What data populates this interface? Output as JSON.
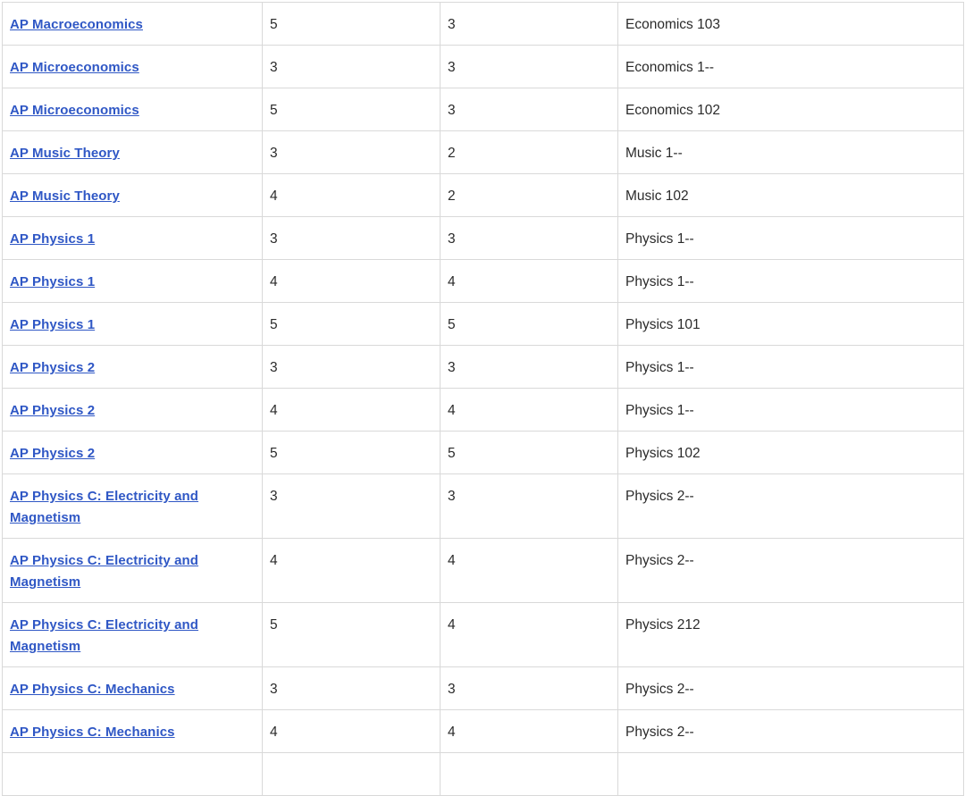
{
  "rows": [
    {
      "exam": "AP Macroeconomics",
      "score": "5",
      "credits": "3",
      "course": "Economics 103"
    },
    {
      "exam": "AP Microeconomics",
      "score": "3",
      "credits": "3",
      "course": "Economics 1--"
    },
    {
      "exam": "AP Microeconomics",
      "score": "5",
      "credits": "3",
      "course": "Economics 102"
    },
    {
      "exam": "AP Music Theory",
      "score": "3",
      "credits": "2",
      "course": "Music 1--"
    },
    {
      "exam": "AP Music Theory",
      "score": "4",
      "credits": "2",
      "course": "Music 102"
    },
    {
      "exam": "AP Physics 1",
      "score": "3",
      "credits": "3",
      "course": "Physics 1--"
    },
    {
      "exam": "AP Physics 1",
      "score": "4",
      "credits": "4",
      "course": "Physics 1--"
    },
    {
      "exam": "AP Physics 1",
      "score": "5",
      "credits": "5",
      "course": "Physics 101"
    },
    {
      "exam": "AP Physics 2",
      "score": "3",
      "credits": "3",
      "course": "Physics 1--"
    },
    {
      "exam": "AP Physics 2",
      "score": "4",
      "credits": "4",
      "course": "Physics 1--"
    },
    {
      "exam": "AP Physics 2",
      "score": "5",
      "credits": "5",
      "course": "Physics 102"
    },
    {
      "exam": "AP Physics C: Electricity and Magnetism",
      "score": "3",
      "credits": "3",
      "course": "Physics 2--"
    },
    {
      "exam": "AP Physics C: Electricity and Magnetism",
      "score": "4",
      "credits": "4",
      "course": "Physics 2--"
    },
    {
      "exam": "AP Physics C: Electricity and Magnetism",
      "score": "5",
      "credits": "4",
      "course": "Physics 212"
    },
    {
      "exam": "AP Physics C: Mechanics",
      "score": "3",
      "credits": "3",
      "course": "Physics 2--"
    },
    {
      "exam": "AP Physics C: Mechanics",
      "score": "4",
      "credits": "4",
      "course": "Physics 2--"
    }
  ]
}
